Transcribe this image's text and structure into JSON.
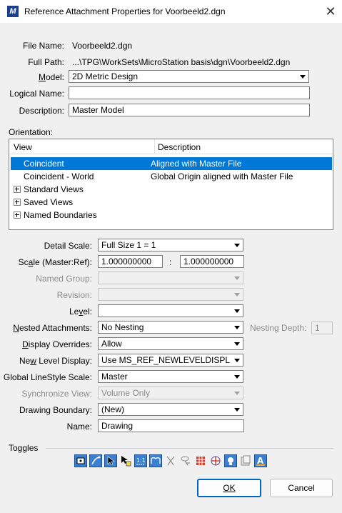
{
  "window": {
    "title": "Reference Attachment Properties for Voorbeeld2.dgn",
    "icon": "microstation-icon"
  },
  "file_name": {
    "label": "File Name:",
    "value": "Voorbeeld2.dgn"
  },
  "full_path": {
    "label": "Full Path:",
    "value": "...\\TPG\\WorkSets\\MicroStation basis\\dgn\\Voorbeeld2.dgn"
  },
  "model": {
    "label": "Model:",
    "value": "2D Metric Design"
  },
  "logical_name": {
    "label": "Logical Name:",
    "value": ""
  },
  "description": {
    "label": "Description:",
    "value": "Master Model"
  },
  "orientation": {
    "label": "Orientation:",
    "columns": [
      "View",
      "Description"
    ],
    "rows": [
      {
        "view": "Coincident",
        "description": "Aligned with Master File",
        "selected": true
      },
      {
        "view": "Coincident - World",
        "description": "Global Origin aligned with Master File"
      },
      {
        "view": "Standard Views",
        "description": "",
        "expandable": true
      },
      {
        "view": "Saved Views",
        "description": "",
        "expandable": true
      },
      {
        "view": "Named Boundaries",
        "description": "",
        "expandable": true
      }
    ]
  },
  "detail_scale": {
    "label": "Detail Scale:",
    "value": "Full Size 1 = 1"
  },
  "scale": {
    "label": "Scale (Master:Ref):",
    "master": "1.000000000",
    "separator": ":",
    "ref": "1.000000000"
  },
  "named_group": {
    "label": "Named Group:",
    "value": "",
    "disabled": true
  },
  "revision": {
    "label": "Revision:",
    "value": "",
    "disabled": true
  },
  "level": {
    "label": "Level:",
    "value": ""
  },
  "nested_attachments": {
    "label": "Nested Attachments:",
    "value": "No Nesting"
  },
  "nesting_depth": {
    "label": "Nesting Depth:",
    "value": "1",
    "disabled": true
  },
  "display_overrides": {
    "label": "Display Overrides:",
    "value": "Allow"
  },
  "new_level_display": {
    "label": "New Level Display:",
    "value": "Use MS_REF_NEWLEVELDISPLAY Co"
  },
  "global_linestyle_scale": {
    "label": "Global LineStyle Scale:",
    "value": "Master"
  },
  "synchronize_view": {
    "label": "Synchronize View:",
    "value": "Volume Only",
    "disabled": true
  },
  "drawing_boundary": {
    "label": "Drawing Boundary:",
    "value": "(New)"
  },
  "name": {
    "label": "Name:",
    "value": "Drawing"
  },
  "toggles": {
    "label": "Toggles",
    "icons": [
      "display-toggle-icon",
      "snap-toggle-icon",
      "locate-toggle-icon",
      "ignore-attachment-toggle-icon",
      "scale-line-styles-toggle-icon",
      "treat-as-element-toggle-icon",
      "clip-front-icon",
      "clip-back-icon",
      "clip-grid-icon",
      "clip-color-icon",
      "lights-icon",
      "raster-icon",
      "annotation-scale-icon"
    ]
  },
  "buttons": {
    "ok": "OK",
    "cancel": "Cancel"
  },
  "colors": {
    "selection": "#0078d7",
    "toggle_on": "#3b7fd0"
  }
}
